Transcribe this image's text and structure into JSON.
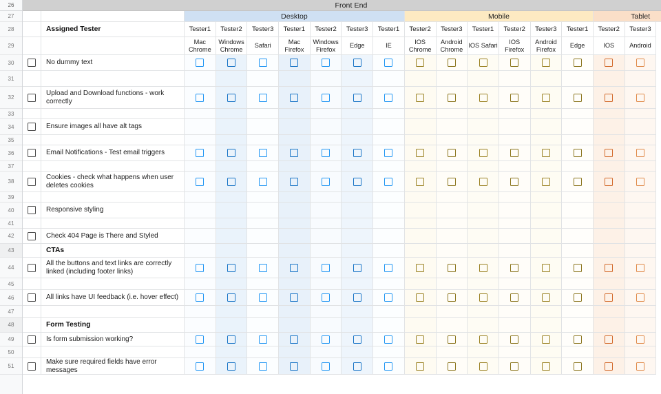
{
  "banner": {
    "row_number": "26",
    "title": "Front End"
  },
  "columns": {
    "groups": [
      {
        "label": "Desktop",
        "span": 7,
        "color": "#cfe0f3"
      },
      {
        "label": "Mobile",
        "span": 6,
        "color": "#fdeac2"
      },
      {
        "label": "Tablet",
        "span": 3,
        "color": "#fadfc8"
      }
    ],
    "testers": [
      "Tester1",
      "Tester2",
      "Tester3",
      "Tester1",
      "Tester2",
      "Tester3",
      "Tester1",
      "Tester2",
      "Tester3",
      "Tester1",
      "Tester2",
      "Tester3",
      "Tester1",
      "Tester2",
      "Tester3"
    ],
    "browsers": [
      "Mac Chrome",
      "Windows Chrome",
      "Safari",
      "Mac Firefox",
      "Windows Firefox",
      "Edge",
      "IE",
      "IOS Chrome",
      "Android Chrome",
      "IOS Safari",
      "IOS Firefox",
      "Android Firefox",
      "Edge",
      "IOS",
      "Android"
    ]
  },
  "header": {
    "row27_number": "27",
    "row28_number": "28",
    "row29_number": "29",
    "assigned_tester_label": "Assigned Tester"
  },
  "rows": [
    {
      "num": "30",
      "type": "task",
      "label": "No dummy text",
      "checkbox": true,
      "checks": true
    },
    {
      "num": "31",
      "type": "spacer",
      "label": "",
      "checkbox": false,
      "checks": false
    },
    {
      "num": "32",
      "type": "task",
      "label": "Upload and Download functions - work correctly",
      "checkbox": true,
      "checks": true
    },
    {
      "num": "33",
      "type": "spacer",
      "label": "",
      "checkbox": false,
      "checks": false
    },
    {
      "num": "34",
      "type": "task",
      "label": "Ensure images all have alt tags",
      "checkbox": true,
      "checks": false
    },
    {
      "num": "35",
      "type": "spacer",
      "label": "",
      "checkbox": false,
      "checks": false
    },
    {
      "num": "36",
      "type": "task",
      "label": "Email Notifications - Test email triggers",
      "checkbox": true,
      "checks": true
    },
    {
      "num": "37",
      "type": "spacer",
      "label": "",
      "checkbox": false,
      "checks": false
    },
    {
      "num": "38",
      "type": "task",
      "label": "Cookies - check what happens when user deletes cookies",
      "checkbox": true,
      "checks": true
    },
    {
      "num": "39",
      "type": "spacer",
      "label": "",
      "checkbox": false,
      "checks": false
    },
    {
      "num": "40",
      "type": "task",
      "label": "Responsive styling",
      "checkbox": true,
      "checks": false
    },
    {
      "num": "41",
      "type": "spacer",
      "label": "",
      "checkbox": false,
      "checks": false
    },
    {
      "num": "42",
      "type": "task",
      "label": "Check 404 Page is There and Styled",
      "checkbox": true,
      "checks": false
    },
    {
      "num": "43",
      "type": "section",
      "label": "CTAs",
      "checkbox": false,
      "checks": false
    },
    {
      "num": "44",
      "type": "task",
      "label": "All the buttons and text links are correctly linked (including footer links)",
      "checkbox": true,
      "checks": true
    },
    {
      "num": "45",
      "type": "spacer",
      "label": "",
      "checkbox": false,
      "checks": false
    },
    {
      "num": "46",
      "type": "task",
      "label": "All links have UI feedback (i.e. hover effect)",
      "checkbox": true,
      "checks": true
    },
    {
      "num": "47",
      "type": "spacer",
      "label": "",
      "checkbox": false,
      "checks": false
    },
    {
      "num": "48",
      "type": "section",
      "label": "Form Testing",
      "checkbox": false,
      "checks": false
    },
    {
      "num": "49",
      "type": "task",
      "label": "Is form submission working?",
      "checkbox": true,
      "checks": true
    },
    {
      "num": "50",
      "type": "spacer",
      "label": "",
      "checkbox": false,
      "checks": false
    },
    {
      "num": "51",
      "type": "task",
      "label": "Make sure required fields have error messages",
      "checkbox": true,
      "checks": true
    }
  ],
  "colors": {
    "desktop_group": "#cfe0f3",
    "mobile_group": "#fdeac2",
    "tablet_group": "#fadfc8",
    "desktop_checkbox": "#2196f3",
    "mobile_checkbox": "#9a8122",
    "tablet_checkbox": "#d2692a",
    "task_checkbox": "#4a4a4a",
    "banner_background": "#d0d0d0"
  }
}
